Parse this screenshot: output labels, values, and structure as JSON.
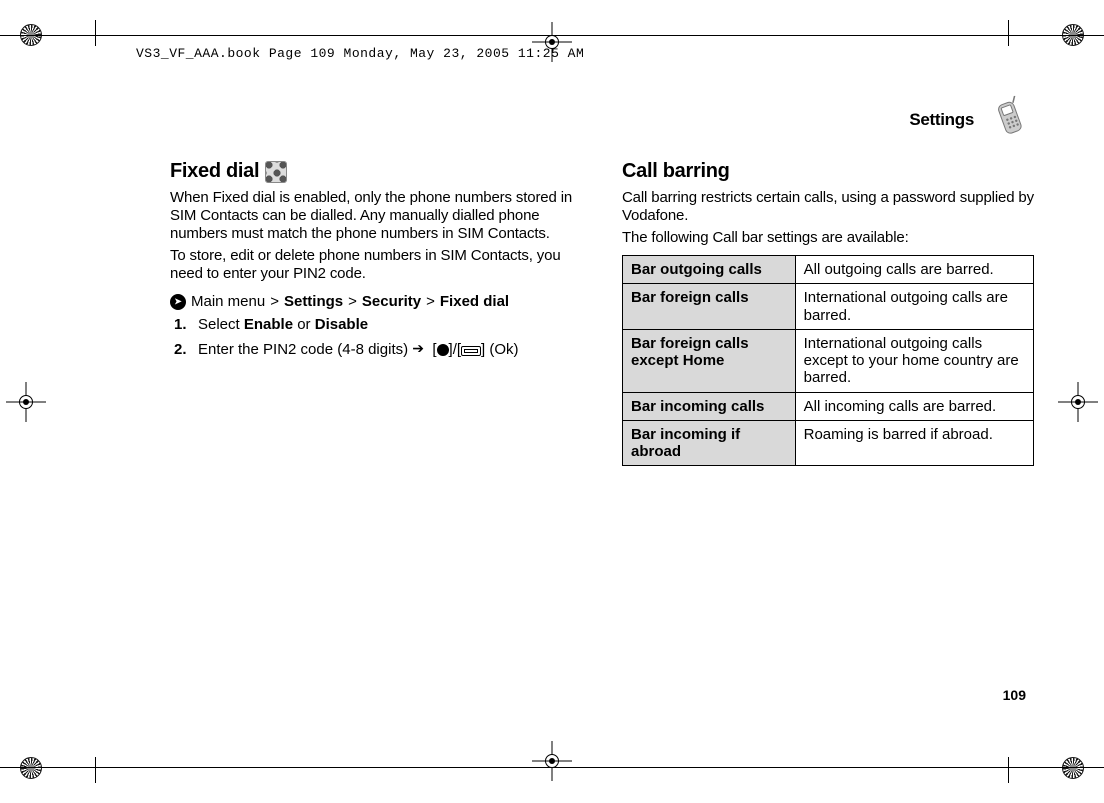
{
  "meta_line": "VS3_VF_AAA.book  Page 109  Monday, May 23, 2005  11:25 AM",
  "running_head": "Settings",
  "page_number": "109",
  "left": {
    "heading": "Fixed dial",
    "para1": "When Fixed dial is enabled, only the phone numbers stored in SIM Contacts can be dialled. Any manually dialled phone numbers must match the phone numbers in SIM Contacts.",
    "para2": "To store, edit or delete phone numbers in SIM Contacts, you need to enter your PIN2 code.",
    "nav_prefix": "Main menu",
    "nav_items": [
      "Settings",
      "Security",
      "Fixed dial"
    ],
    "step1_prefix": "Select ",
    "step1_opt1": "Enable",
    "step1_mid": " or ",
    "step1_opt2": "Disable",
    "step2_prefix": "Enter the PIN2 code (4-8 digits) ",
    "step2_suffix": " (Ok)"
  },
  "right": {
    "heading": "Call barring",
    "para1": "Call barring restricts certain calls, using a password supplied by Vodafone.",
    "para2": "The following Call bar settings are available:",
    "rows": [
      {
        "name": "Bar outgoing calls",
        "desc": "All outgoing calls are barred."
      },
      {
        "name": "Bar foreign calls",
        "desc": "International outgoing calls are barred."
      },
      {
        "name": "Bar foreign calls except Home",
        "desc": "International outgoing calls except to your home country are barred."
      },
      {
        "name": "Bar incoming calls",
        "desc": "All incoming calls are barred."
      },
      {
        "name": "Bar incoming if abroad",
        "desc": "Roaming is barred if abroad."
      }
    ]
  }
}
